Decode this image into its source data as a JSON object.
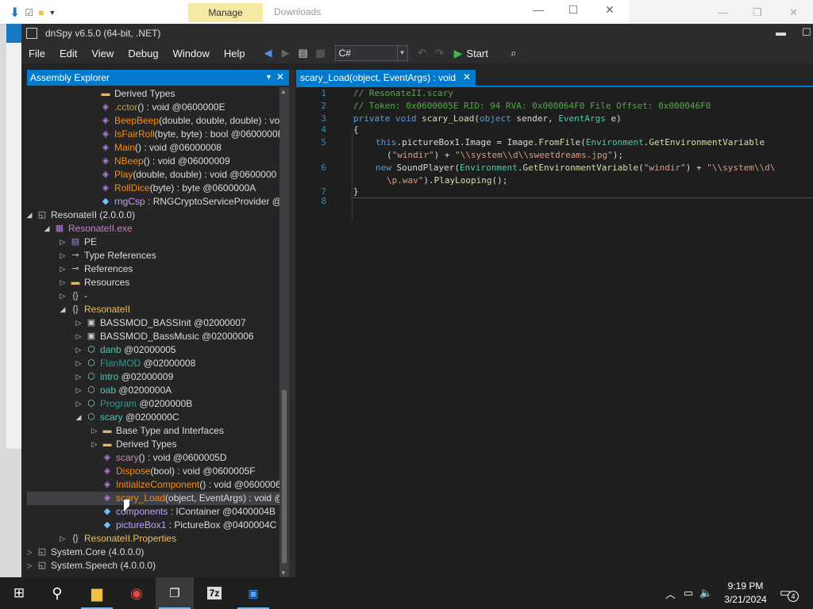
{
  "background_window": {
    "manage_tab": "Manage",
    "downloads_tab": "Downloads"
  },
  "window": {
    "title": "dnSpy v6.5.0 (64-bit, .NET)"
  },
  "menu": [
    "File",
    "Edit",
    "View",
    "Debug",
    "Window",
    "Help"
  ],
  "toolbar": {
    "language": "C#",
    "start_label": "Start"
  },
  "assembly_explorer": {
    "title": "Assembly Explorer",
    "rows": [
      {
        "label": "Derived Types",
        "extra": "",
        "color": "#dcdcdc",
        "indent": 94,
        "expander": "",
        "icon": "folder-icon"
      },
      {
        "label": ".cctor",
        "extra": "() : void @0600000E",
        "color": "#b8a060",
        "indent": 94,
        "expander": "",
        "icon": "method-icon"
      },
      {
        "label": "BeepBeep",
        "extra": "(double, double, double) : vo",
        "color": "#ff8c00",
        "indent": 94,
        "expander": "",
        "icon": "method-icon"
      },
      {
        "label": "IsFairRoll",
        "extra": "(byte, byte) : bool @0600000E",
        "color": "#ff8c00",
        "indent": 94,
        "expander": "",
        "icon": "method-icon"
      },
      {
        "label": "Main",
        "extra": "() : void @06000008",
        "color": "#ff8c00",
        "indent": 94,
        "expander": "",
        "icon": "method-icon"
      },
      {
        "label": "NBeep",
        "extra": "() : void @06000009",
        "color": "#ff8c00",
        "indent": 94,
        "expander": "",
        "icon": "method-icon"
      },
      {
        "label": "Play",
        "extra": "(double, double) : void @0600000",
        "color": "#ff8c00",
        "indent": 94,
        "expander": "",
        "icon": "method-icon"
      },
      {
        "label": "RollDice",
        "extra": "(byte) : byte @0600000A",
        "color": "#ff8c00",
        "indent": 94,
        "expander": "",
        "icon": "method-icon"
      },
      {
        "label": "rngCsp",
        "extra": " : RNGCryptoServiceProvider @",
        "color": "#c0a0ff",
        "indent": 94,
        "expander": "",
        "icon": "field-icon"
      },
      {
        "label": "ResonateII (2.0.0.0)",
        "extra": "",
        "color": "#dcdcdc",
        "indent": 14,
        "expander": "◢",
        "icon": "assembly-icon"
      },
      {
        "label": "ResonateII.exe",
        "extra": "",
        "color": "#c586c0",
        "indent": 36,
        "expander": "◢",
        "icon": "module-icon"
      },
      {
        "label": "PE",
        "extra": "",
        "color": "#dcdcdc",
        "indent": 56,
        "expander": "▷",
        "icon": "pe-icon"
      },
      {
        "label": "Type References",
        "extra": "",
        "color": "#dcdcdc",
        "indent": 56,
        "expander": "▷",
        "icon": "reference-icon"
      },
      {
        "label": "References",
        "extra": "",
        "color": "#dcdcdc",
        "indent": 56,
        "expander": "▷",
        "icon": "reference-icon"
      },
      {
        "label": "Resources",
        "extra": "",
        "color": "#dcdcdc",
        "indent": 56,
        "expander": "▷",
        "icon": "folder-icon"
      },
      {
        "label": "-",
        "extra": "",
        "color": "#dcdcdc",
        "indent": 56,
        "expander": "▷",
        "icon": "namespace-icon"
      },
      {
        "label": "ResonateII",
        "extra": "",
        "color": "#f0c060",
        "indent": 56,
        "expander": "◢",
        "icon": "namespace-icon"
      },
      {
        "label": "BASSMOD_BASSInit",
        "extra": " @02000007",
        "color": "#dcdcdc",
        "indent": 76,
        "expander": "▷",
        "icon": "struct-icon"
      },
      {
        "label": "BASSMOD_BassMusic",
        "extra": " @02000006",
        "color": "#dcdcdc",
        "indent": 76,
        "expander": "▷",
        "icon": "struct-icon"
      },
      {
        "label": "danb",
        "extra": " @02000005",
        "color": "#4ec9b0",
        "indent": 76,
        "expander": "▷",
        "icon": "class-icon"
      },
      {
        "label": "FlanMOD",
        "extra": " @02000008",
        "color": "#2a9d8f",
        "indent": 76,
        "expander": "▷",
        "icon": "class-icon"
      },
      {
        "label": "intro",
        "extra": " @02000009",
        "color": "#4ec9b0",
        "indent": 76,
        "expander": "▷",
        "icon": "class-icon"
      },
      {
        "label": "oab",
        "extra": " @0200000A",
        "color": "#4ec9b0",
        "indent": 76,
        "expander": "▷",
        "icon": "class-icon"
      },
      {
        "label": "Program",
        "extra": " @0200000B",
        "color": "#2a9d8f",
        "indent": 76,
        "expander": "▷",
        "icon": "class-icon"
      },
      {
        "label": "scary",
        "extra": " @0200000C",
        "color": "#4ec9b0",
        "indent": 76,
        "expander": "◢",
        "icon": "class-icon"
      },
      {
        "label": "Base Type and Interfaces",
        "extra": "",
        "color": "#dcdcdc",
        "indent": 96,
        "expander": "▷",
        "icon": "folder-icon"
      },
      {
        "label": "Derived Types",
        "extra": "",
        "color": "#dcdcdc",
        "indent": 96,
        "expander": "▷",
        "icon": "folder-icon"
      },
      {
        "label": "scary",
        "extra": "() : void @0600005D",
        "color": "#c586c0",
        "indent": 96,
        "expander": "",
        "icon": "method-icon"
      },
      {
        "label": "Dispose",
        "extra": "(bool) : void @0600005F",
        "color": "#ff8c00",
        "indent": 96,
        "expander": "",
        "icon": "method-icon"
      },
      {
        "label": "InitializeComponent",
        "extra": "() : void @0600006",
        "color": "#ff8c00",
        "indent": 96,
        "expander": "",
        "icon": "method-icon"
      },
      {
        "label": "scary_Load",
        "extra": "(object, EventArgs) : void @",
        "color": "#ff8c00",
        "indent": 96,
        "expander": "",
        "icon": "method-icon",
        "selected": true
      },
      {
        "label": "components",
        "extra": " : IContainer @0400004B",
        "color": "#c0a0ff",
        "indent": 96,
        "expander": "",
        "icon": "field-icon"
      },
      {
        "label": "pictureBox1",
        "extra": " : PictureBox @0400004C",
        "color": "#c0a0ff",
        "indent": 96,
        "expander": "",
        "icon": "field-icon"
      },
      {
        "label": "ResonateII.Properties",
        "extra": "",
        "color": "#f0c060",
        "indent": 56,
        "expander": "▷",
        "icon": "namespace-icon"
      },
      {
        "label": "System.Core (4.0.0.0)",
        "extra": "",
        "color": "#dcdcdc",
        "indent": 14,
        "expander": "▷",
        "icon": "assembly-icon"
      },
      {
        "label": "System.Speech (4.0.0.0)",
        "extra": "",
        "color": "#dcdcdc",
        "indent": 14,
        "expander": "▷",
        "icon": "assembly-icon"
      }
    ]
  },
  "editor": {
    "tab_title": "scary_Load(object, EventArgs) : void",
    "line_numbers": [
      "1",
      "2",
      "3",
      "4",
      "5",
      "",
      "6",
      "",
      "7",
      "8"
    ],
    "lines": {
      "l1": "// ResonateII.scary",
      "l2": "// Token: 0x0600005E RID: 94 RVA: 0x000064F0 File Offset: 0x000046F0",
      "l3_kw": "private void ",
      "l3_name": "scary_Load",
      "l3_p1": "(",
      "l3_t1": "object",
      "l3_p2": " sender, ",
      "l3_t2": "EventArgs",
      "l3_p3": " e)",
      "l4": "{",
      "l5_this": "this",
      "l5_a": ".pictureBox1.Image = Image.",
      "l5_m1": "FromFile",
      "l5_b": "(",
      "l5_env": "Environment",
      "l5_c": ".",
      "l5_m2": "GetEnvironmentVariable",
      "l5w_a": "(",
      "l5w_s1": "\"windir\"",
      "l5w_b": ") + ",
      "l5w_s2": "\"\\\\system\\\\d\\\\sweetdreams.jpg\"",
      "l5w_c": ");",
      "l6_new": "new ",
      "l6_a": "SoundPlayer(",
      "l6_env": "Environment",
      "l6_b": ".",
      "l6_m": "GetEnvironmentVariable",
      "l6_c": "(",
      "l6_s1": "\"windir\"",
      "l6_d": ") + ",
      "l6_s2": "\"\\\\system\\\\d\\",
      "l6w_s": "\\p.wav\"",
      "l6w_a": ").",
      "l6w_m": "PlayLooping",
      "l6w_b": "();",
      "l7": "}"
    }
  },
  "taskbar": {
    "time": "9:19 PM",
    "date": "3/21/2024",
    "notification_count": "4"
  }
}
